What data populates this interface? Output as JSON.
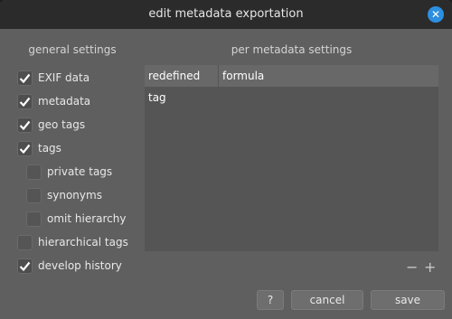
{
  "dialog": {
    "title": "edit metadata exportation",
    "close_glyph": "✕"
  },
  "general": {
    "header": "general settings",
    "options": [
      {
        "label": "EXIF data",
        "checked": true
      },
      {
        "label": "metadata",
        "checked": true
      },
      {
        "label": "geo tags",
        "checked": true
      },
      {
        "label": "tags",
        "checked": true
      },
      {
        "label": "private tags",
        "checked": false
      },
      {
        "label": "synonyms",
        "checked": false
      },
      {
        "label": "omit hierarchy",
        "checked": false
      },
      {
        "label": "hierarchical tags",
        "checked": false
      },
      {
        "label": "develop history",
        "checked": true
      }
    ]
  },
  "per_metadata": {
    "header": "per metadata settings",
    "columns": [
      "redefined tag",
      "formula"
    ]
  },
  "list_controls": {
    "remove": "−",
    "add": "+"
  },
  "buttons": {
    "help": "?",
    "cancel": "cancel",
    "save": "save"
  },
  "colors": {
    "accent": "#2d8fe0",
    "dialog_bg": "#5f5f5f",
    "titlebar_bg": "#2b2b2b"
  }
}
